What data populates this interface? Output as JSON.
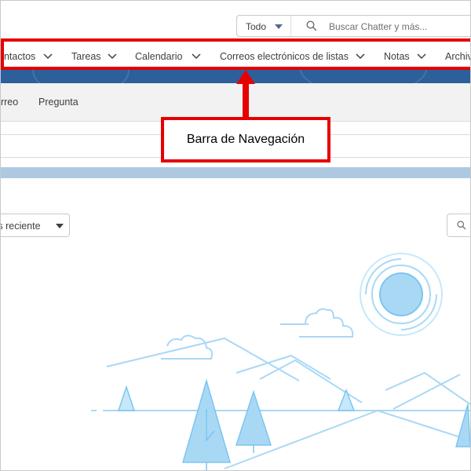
{
  "header": {
    "scope_label": "Todo",
    "search_placeholder": "Buscar Chatter y más..."
  },
  "nav": {
    "items": [
      {
        "label": "Contactos"
      },
      {
        "label": "Tareas"
      },
      {
        "label": "Calendario"
      },
      {
        "label": "Correos electrónicos de listas"
      },
      {
        "label": "Notas"
      },
      {
        "label": "Archivos"
      }
    ]
  },
  "publisher": {
    "tabs": [
      {
        "label": "Correo"
      },
      {
        "label": "Pregunta"
      }
    ]
  },
  "feed": {
    "sort_label": "Más reciente"
  },
  "annotation": {
    "callout_text": "Barra de Navegación",
    "color": "#e60000"
  },
  "colors": {
    "brand_blue": "#2d5f9b",
    "illustration_blue": "#a9d8f5"
  },
  "icons": [
    "chevron-down-icon",
    "search-icon",
    "caret-down-icon"
  ]
}
